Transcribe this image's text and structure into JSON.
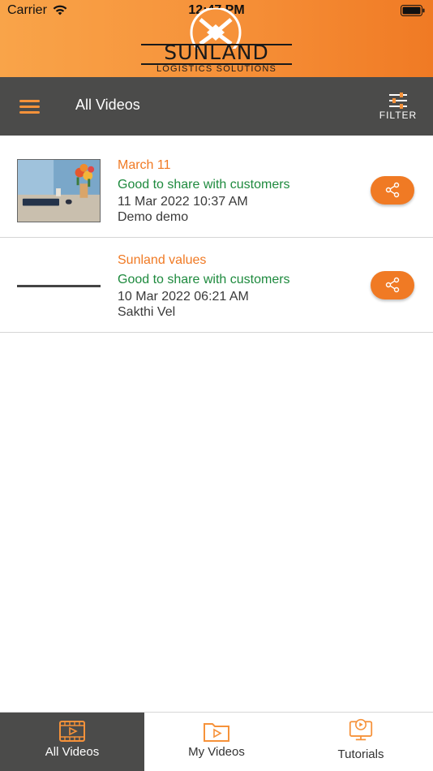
{
  "status": {
    "carrier": "Carrier",
    "time": "12:47 PM"
  },
  "brand": {
    "title": "SUNLAND",
    "subtitle": "LOGISTICS SOLUTIONS",
    "accent_color": "#f6923a"
  },
  "toolbar": {
    "title": "All Videos",
    "filter_label": "FILTER"
  },
  "videos": [
    {
      "title": "March 11",
      "tag": "Good to share with customers",
      "date": "11 Mar 2022 10:37 AM",
      "author": "Demo demo",
      "thumbnail": "photo"
    },
    {
      "title": "Sunland values",
      "tag": "Good to share with customers",
      "date": "10 Mar 2022 06:21 AM",
      "author": "Sakthi Vel",
      "thumbnail": "blank"
    }
  ],
  "tabs": [
    {
      "label": "All Videos",
      "icon": "film-icon",
      "active": true
    },
    {
      "label": "My Videos",
      "icon": "video-folder-icon",
      "active": false
    },
    {
      "label": "Tutorials",
      "icon": "tutorial-monitor-icon",
      "active": false
    }
  ],
  "colors": {
    "orange": "#f07a24",
    "green": "#1e8a3e",
    "toolbar_bg": "#4b4b4a"
  }
}
